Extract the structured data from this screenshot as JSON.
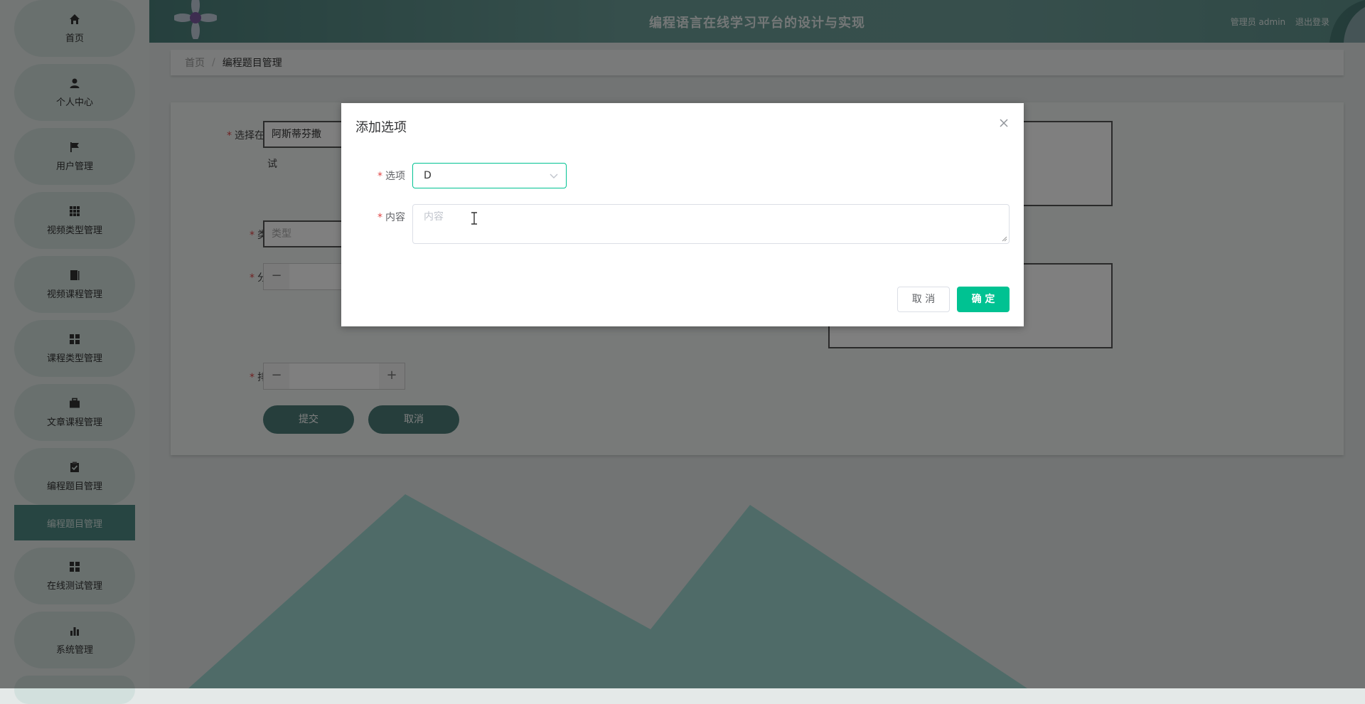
{
  "sidebar": {
    "items": [
      {
        "label": "首页",
        "icon": "home-icon"
      },
      {
        "label": "个人中心",
        "icon": "user-icon"
      },
      {
        "label": "用户管理",
        "icon": "flag-icon"
      },
      {
        "label": "视频类型管理",
        "icon": "grid-icon"
      },
      {
        "label": "视频课程管理",
        "icon": "book-icon"
      },
      {
        "label": "课程类型管理",
        "icon": "apps-icon"
      },
      {
        "label": "文章课程管理",
        "icon": "briefcase-icon"
      },
      {
        "label": "编程题目管理",
        "icon": "clipboard-icon"
      },
      {
        "label": "在线测试管理",
        "icon": "apps-icon"
      },
      {
        "label": "系统管理",
        "icon": "bar-chart-icon"
      }
    ],
    "active_sub": "编程题目管理"
  },
  "header": {
    "title": "编程语言在线学习平台的设计与实现",
    "role": "管理员 admin",
    "logout": "退出登录"
  },
  "breadcrumb": {
    "home": "首页",
    "sep": "/",
    "current": "编程题目管理"
  },
  "form": {
    "exam_label_1": "选择在线测",
    "exam_label_2": "试",
    "exam_value": "阿斯蒂芬撒",
    "type_label": "类型",
    "type_placeholder": "类型",
    "score_label": "分数",
    "sort_label": "排序",
    "minus": "−",
    "plus": "+",
    "submit": "提交",
    "cancel": "取消"
  },
  "dialog": {
    "title": "添加选项",
    "option_label": "选项",
    "option_value": "D",
    "content_label": "内容",
    "content_placeholder": "内容",
    "cancel": "取 消",
    "confirm": "确 定"
  },
  "colors": {
    "accent": "#00c292",
    "sidebar_active": "#4f8a85",
    "header": "#5f928c"
  }
}
